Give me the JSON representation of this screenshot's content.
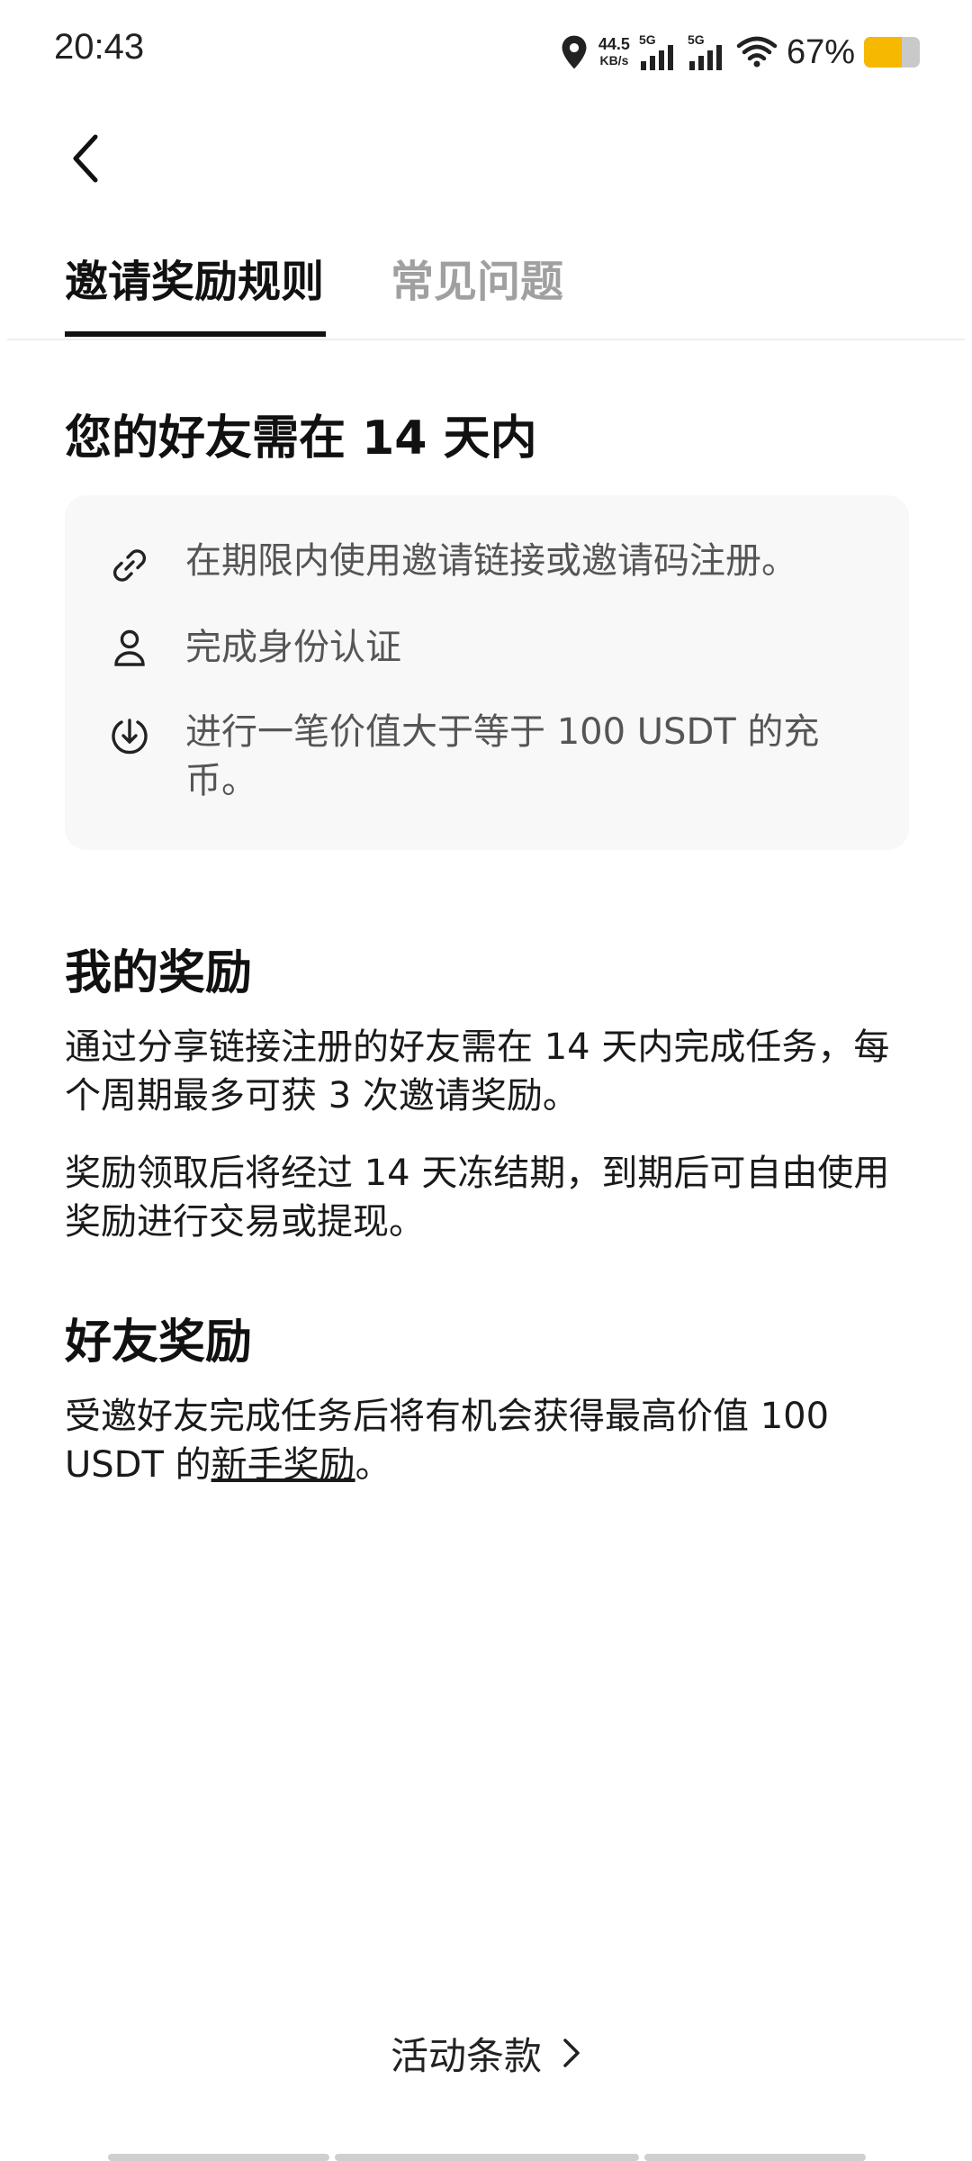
{
  "status_bar": {
    "time": "20:43",
    "speed_value": "44.5",
    "speed_unit": "KB/s",
    "network1": "5G",
    "network2": "5G",
    "battery_percent": "67%",
    "battery_level": 0.67,
    "icons": [
      "location-icon",
      "signal-icon",
      "signal-icon",
      "wifi-icon",
      "battery-icon"
    ]
  },
  "nav": {
    "back_icon": "chevron-left-icon",
    "tabs": [
      {
        "label": "邀请奖励规则",
        "active": true
      },
      {
        "label": "常见问题",
        "active": false
      }
    ]
  },
  "requirements": {
    "title": "您的好友需在 14 天内",
    "items": [
      {
        "icon": "link-icon",
        "text": "在期限内使用邀请链接或邀请码注册。"
      },
      {
        "icon": "user-icon",
        "text": "完成身份认证"
      },
      {
        "icon": "deposit-icon",
        "text": "进行一笔价值大于等于 100 USDT 的充币。"
      }
    ]
  },
  "my_rewards": {
    "title": "我的奖励",
    "paragraphs": [
      "通过分享链接注册的好友需在 14 天内完成任务，每个周期最多可获 3 次邀请奖励。",
      "奖励领取后将经过 14 天冻结期，到期后可自由使用奖励进行交易或提现。"
    ]
  },
  "friend_rewards": {
    "title": "好友奖励",
    "text_before": "受邀好友完成任务后将有机会获得最高价值 100 USDT 的",
    "link": "新手奖励",
    "text_after": "。"
  },
  "footer": {
    "terms_label": "活动条款",
    "terms_icon": "chevron-right-icon"
  },
  "colors": {
    "accent": "#111111",
    "inactive_tab": "#a0a0a0",
    "card_bg": "#f8f8f8",
    "battery": "#f6b800"
  }
}
